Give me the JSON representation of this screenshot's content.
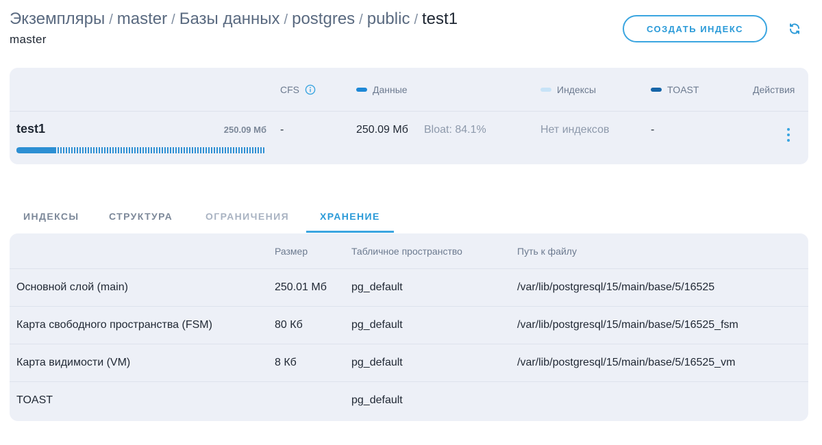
{
  "breadcrumb": {
    "items": [
      "Экземпляры",
      "master",
      "Базы данных",
      "postgres",
      "public"
    ],
    "separator": "/",
    "current": "test1"
  },
  "subtitle": "master",
  "actions": {
    "create_index_label": "СОЗДАТЬ ИНДЕКС",
    "refresh_icon": "refresh-icon"
  },
  "summary": {
    "headers": {
      "cfs": "CFS",
      "data": "Данные",
      "indexes": "Индексы",
      "toast": "TOAST",
      "actions": "Действия"
    },
    "legend_colors": {
      "data": "#1e88d6",
      "indexes": "#c7e3f7",
      "toast": "#1665a8"
    },
    "row": {
      "name": "test1",
      "size": "250.09 Мб",
      "cfs": "-",
      "data": "250.09 Мб",
      "bloat": "Bloat: 84.1%",
      "indexes": "Нет индексов",
      "toast": "-",
      "bloat_fraction": 0.159
    }
  },
  "tabs": [
    {
      "label": "ИНДЕКСЫ",
      "state": "normal"
    },
    {
      "label": "СТРУКТУРА",
      "state": "normal"
    },
    {
      "label": "ОГРАНИЧЕНИЯ",
      "state": "disabled"
    },
    {
      "label": "ХРАНЕНИЕ",
      "state": "active"
    }
  ],
  "storage": {
    "columns": [
      "",
      "Размер",
      "Табличное пространство",
      "Путь к файлу"
    ],
    "rows": [
      {
        "layer": "Основной слой (main)",
        "size": "250.01 Мб",
        "tablespace": "pg_default",
        "path": "/var/lib/postgresql/15/main/base/5/16525"
      },
      {
        "layer": "Карта свободного пространства (FSM)",
        "size": "80 Кб",
        "tablespace": "pg_default",
        "path": "/var/lib/postgresql/15/main/base/5/16525_fsm"
      },
      {
        "layer": "Карта видимости (VM)",
        "size": "8 Кб",
        "tablespace": "pg_default",
        "path": "/var/lib/postgresql/15/main/base/5/16525_vm"
      },
      {
        "layer": "TOAST",
        "size": "",
        "tablespace": "pg_default",
        "path": ""
      }
    ]
  }
}
